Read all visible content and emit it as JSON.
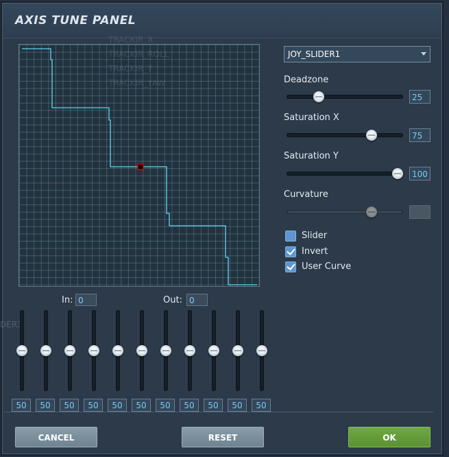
{
  "panel": {
    "title": "AXIS TUNE PANEL"
  },
  "graph": {
    "ghost_items": [
      "TRACKIR_X",
      "TRACKIR_ROLL",
      "TRACKIR_Y",
      "TRACKIR_YAW"
    ],
    "side_ghost_text": "DER3",
    "line_color": "#5fd7f0",
    "marker_color": "#e00000"
  },
  "io": {
    "in_label": "In:",
    "in_value": "0",
    "out_label": "Out:",
    "out_value": "0"
  },
  "curve_points": [
    "50",
    "50",
    "50",
    "50",
    "50",
    "50",
    "50",
    "50",
    "50",
    "50",
    "50"
  ],
  "curve_levels": [
    0.5,
    0.5,
    0.5,
    0.5,
    0.5,
    0.5,
    0.5,
    0.5,
    0.5,
    0.5,
    0.5
  ],
  "axis_select": {
    "selected": "JOY_SLIDER1"
  },
  "params": {
    "deadzone": {
      "label": "Deadzone",
      "value": "25",
      "level": 0.25
    },
    "saturation_x": {
      "label": "Saturation X",
      "value": "75",
      "level": 0.75
    },
    "saturation_y": {
      "label": "Saturation Y",
      "value": "100",
      "level": 1.0
    },
    "curvature": {
      "label": "Curvature",
      "value": "",
      "level": 0.75
    }
  },
  "options": {
    "slider": {
      "label": "Slider",
      "checked": false
    },
    "invert": {
      "label": "Invert",
      "checked": true
    },
    "user_curve": {
      "label": "User Curve",
      "checked": true
    }
  },
  "buttons": {
    "cancel": "CANCEL",
    "reset": "RESET",
    "ok": "OK"
  },
  "colors": {
    "accent_blue": "#5e96d0",
    "ok_green": "#6aa23e",
    "value_text": "#78cdf0"
  }
}
